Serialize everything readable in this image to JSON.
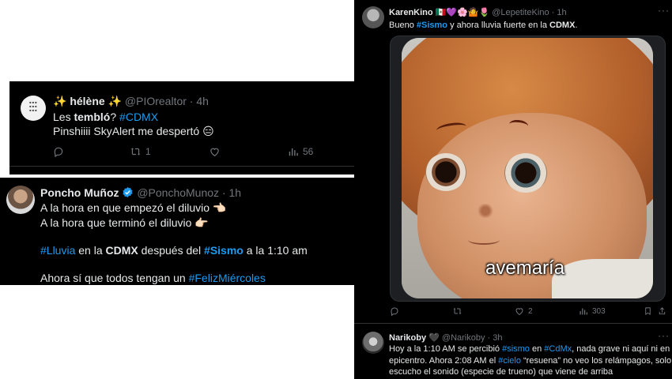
{
  "tweet1": {
    "display_name": "✨ hélène ✨",
    "handle": "@PIOrealtor",
    "time": "4h",
    "line1_a": "Les ",
    "line1_b": "tembló",
    "line1_c": "? ",
    "line1_tag": "#CDMX",
    "line2": "Pinshiiii SkyAlert me despertó 😑",
    "retweets": "1",
    "views": "56"
  },
  "tweet2": {
    "display_name": "Poncho Muñoz",
    "handle": "@PonchoMunoz",
    "time": "1h",
    "line1": "A la hora en que empezó el diluvio 👈🏻",
    "line2": "A la hora que terminó el diluvio 👉🏻",
    "l3_tag1": "#Lluvia",
    "l3_t1": " en la ",
    "l3_b1": "CDMX",
    "l3_t2": " después del ",
    "l3_tag2": "#Sismo",
    "l3_t3": " a la 1:10 am",
    "l4_t1": "Ahora sí que todos tengan un ",
    "l4_tag": "#FelizMiércoles"
  },
  "tweet3": {
    "display_name": "KarenKino",
    "name_emojis": "🇲🇽💜🌸🤷🌷",
    "handle": "@LepetiteKino",
    "time": "1h",
    "t1": "Bueno  ",
    "tag": "#Sismo",
    "t2": " y ahora lluvia fuerte en la ",
    "b1": "CDMX",
    "t3": ".",
    "image_caption": "avemaría",
    "likes": "2",
    "views": "303"
  },
  "tweet4": {
    "display_name": "Narikoby",
    "name_emoji": "🖤",
    "handle": "@Narikoby",
    "time": "3h",
    "l1_t1": "Hoy a la 1:10 AM se percibió ",
    "l1_tag1": "#sismo",
    "l1_t2": " en ",
    "l1_tag2": "#CdMx",
    "l1_t3": ", nada grave ni aquí ni en su",
    "l2_t1": "epicentro. Ahora 2:08 AM el ",
    "l2_tag": "#cielo",
    "l2_t2": " “resuena” no veo los relámpagos, solo",
    "l3": "escucho el sonido (especie de trueno) que viene de arriba"
  },
  "icons": [
    "reply-icon",
    "retweet-icon",
    "like-icon",
    "views-icon",
    "bookmark-icon",
    "share-icon",
    "more-icon",
    "verified-icon"
  ],
  "colors": {
    "background": "#000000",
    "text": "#e7e9ea",
    "muted": "#71767b",
    "accent": "#1d9bf0"
  }
}
